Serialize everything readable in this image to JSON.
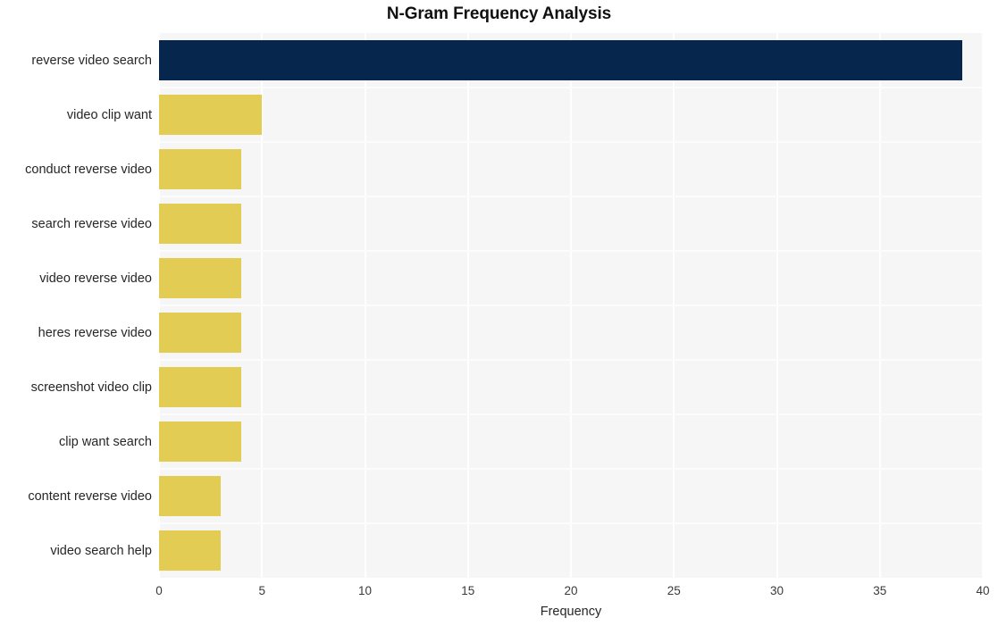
{
  "chart_data": {
    "type": "bar",
    "orientation": "horizontal",
    "title": "N-Gram Frequency Analysis",
    "xlabel": "Frequency",
    "ylabel": "",
    "xlim": [
      0,
      40
    ],
    "ylim": null,
    "grid": true,
    "legend": null,
    "xticks": [
      0,
      5,
      10,
      15,
      20,
      25,
      30,
      35,
      40
    ],
    "xtick_labels": [
      "0",
      "5",
      "10",
      "15",
      "20",
      "25",
      "30",
      "35",
      "40"
    ],
    "categories": [
      "reverse video search",
      "video clip want",
      "conduct reverse video",
      "search reverse video",
      "video reverse video",
      "heres reverse video",
      "screenshot video clip",
      "clip want search",
      "content reverse video",
      "video search help"
    ],
    "values": [
      39,
      5,
      4,
      4,
      4,
      4,
      4,
      4,
      3,
      3
    ],
    "bar_colors": [
      "#07264d",
      "#e2cc53",
      "#e2cc53",
      "#e2cc53",
      "#e2cc53",
      "#e2cc53",
      "#e2cc53",
      "#e2cc53",
      "#e2cc53",
      "#e2cc53"
    ]
  },
  "style": {
    "plot_background": "#f6f6f7",
    "figure_background": "#ffffff",
    "gridline_color": "#ffffff",
    "highlight_color": "#07264d",
    "bar_color": "#e2cc53",
    "text_color": "#262626"
  }
}
